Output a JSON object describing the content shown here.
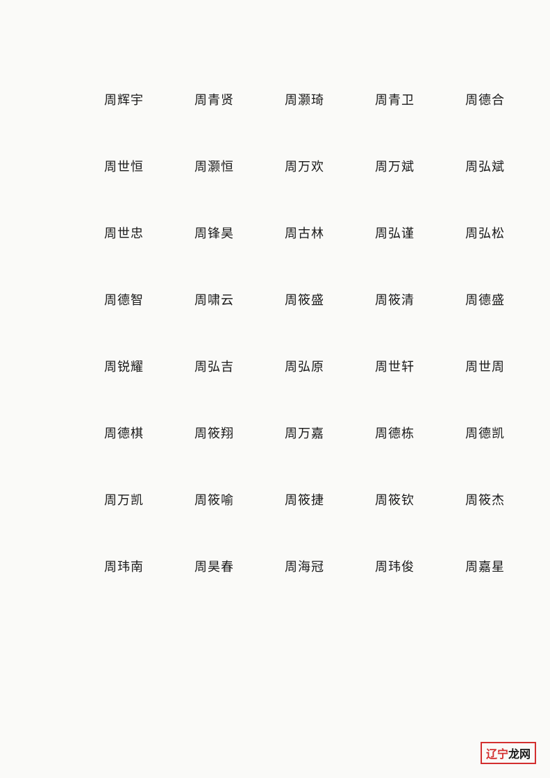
{
  "rows": [
    {
      "id": "row1",
      "names": [
        "周辉宇",
        "周青贤",
        "周灏琦",
        "周青卫",
        "周德合"
      ]
    },
    {
      "id": "row2",
      "names": [
        "周世恒",
        "周灏恒",
        "周万欢",
        "周万斌",
        "周弘斌"
      ]
    },
    {
      "id": "row3",
      "names": [
        "周世忠",
        "周锋昊",
        "周古林",
        "周弘谨",
        "周弘松"
      ]
    },
    {
      "id": "row4",
      "names": [
        "周德智",
        "周啸云",
        "周筱盛",
        "周筱清",
        "周德盛"
      ]
    },
    {
      "id": "row5",
      "names": [
        "周锐耀",
        "周弘吉",
        "周弘原",
        "周世轩",
        "周世周"
      ]
    },
    {
      "id": "row6",
      "names": [
        "周德棋",
        "周筱翔",
        "周万嘉",
        "周德栋",
        "周德凯"
      ]
    },
    {
      "id": "row7",
      "names": [
        "周万凯",
        "周筱喻",
        "周筱捷",
        "周筱钦",
        "周筱杰"
      ]
    },
    {
      "id": "row8",
      "names": [
        "周玮南",
        "周昊春",
        "周海冠",
        "周玮俊",
        "周嘉星"
      ]
    }
  ],
  "watermark": {
    "text": "辽宁龙网",
    "liao": "辽",
    "ning": "宁",
    "long": "龙",
    "wang": "网"
  }
}
